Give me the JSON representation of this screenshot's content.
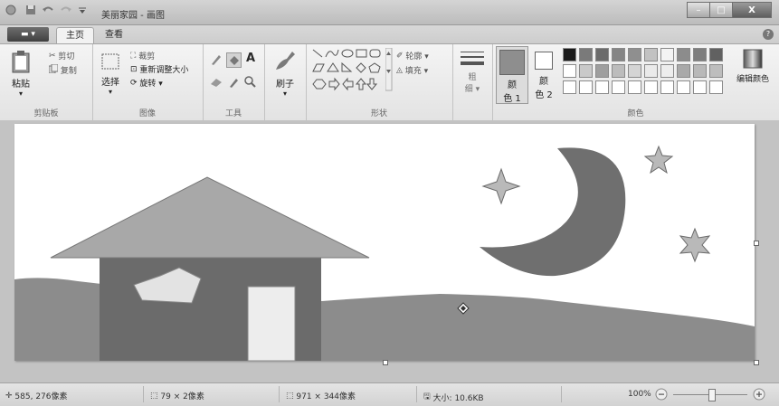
{
  "titlebar": {
    "title": "美丽家园 - 画图",
    "minimize_label": "–",
    "maximize_label": "□",
    "close_label": "X"
  },
  "tabs": {
    "file_label": "▬ ▾",
    "home": "主页",
    "view": "查看",
    "help": "?"
  },
  "ribbon": {
    "clipboard": {
      "paste": "粘贴",
      "cut": "剪切",
      "copy": "复制",
      "group": "剪贴板"
    },
    "image": {
      "select": "选择",
      "crop": "裁剪",
      "resize": "重新调整大小",
      "rotate": "旋转 ▾",
      "group": "图像"
    },
    "tools": {
      "group": "工具"
    },
    "brushes": {
      "label": "刷子"
    },
    "shapes": {
      "outline": "轮廓 ▾",
      "fill": "填充 ▾",
      "group": "形状"
    },
    "size": {
      "line1": "粗",
      "line2": "细 ▾"
    },
    "colors": {
      "color1_line1": "颜",
      "color1_line2": "色 1",
      "color2_line1": "颜",
      "color2_line2": "色 2",
      "edit": "编辑颜色",
      "group": "颜色",
      "palette_row1": [
        "#1a1a1a",
        "#7a7a7a",
        "#6b6b6b",
        "#858585",
        "#8f8f8f",
        "#c2c2c2",
        "#f4f4f4",
        "#8c8c8c",
        "#7e7e7e",
        "#616161"
      ],
      "palette_row2": [
        "#ffffff",
        "#c9c9c9",
        "#9e9e9e",
        "#bcbcbc",
        "#d4d4d4",
        "#eaeaea",
        "#ededed",
        "#a9a9a9",
        "#b8b8b8",
        "#bdbdbd"
      ],
      "palette_row3": [
        "#ffffff",
        "#ffffff",
        "#ffffff",
        "#ffffff",
        "#ffffff",
        "#ffffff",
        "#ffffff",
        "#ffffff",
        "#ffffff",
        "#ffffff"
      ],
      "color1_value": "#8e8e8e",
      "color2_value": "#ffffff"
    }
  },
  "drawing_colors": {
    "sky": "#ffffff",
    "ground": "#8c8c8c",
    "house_wall": "#6b6b6b",
    "roof": "#a8a8a8",
    "door": "#ededed",
    "window": "#e3e3e3",
    "moon": "#6f6f6f",
    "stars": "#b9b9b9"
  },
  "status": {
    "cursor_pos": "585, 276像素",
    "selection_size": "79 × 2像素",
    "canvas_size": "971 × 344像素",
    "file_size": "大小: 10.6KB",
    "zoom": "100%"
  }
}
